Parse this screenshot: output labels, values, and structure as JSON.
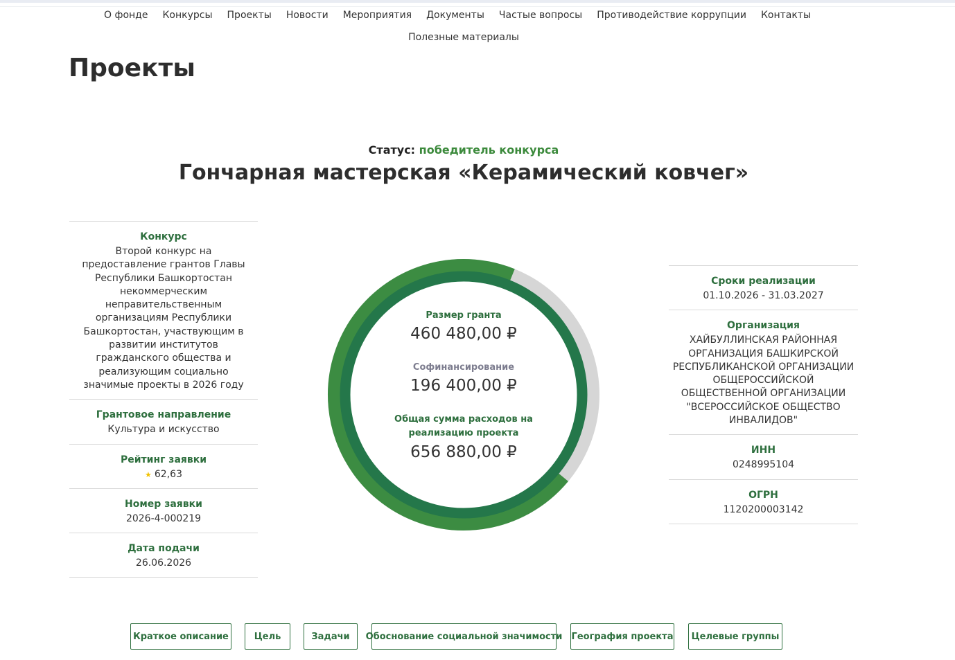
{
  "nav": {
    "items": [
      "О фонде",
      "Конкурсы",
      "Проекты",
      "Новости",
      "Мероприятия",
      "Документы",
      "Частые вопросы",
      "Противодействие коррупции",
      "Контакты"
    ],
    "second_row": "Полезные материалы"
  },
  "page_title": "Проекты",
  "status": {
    "label": "Статус:",
    "value": "победитель конкурса"
  },
  "project_title": "Гончарная мастерская «Керамический ковчег»",
  "left": {
    "competition": {
      "label": "Конкурс",
      "value": "Второй конкурс на предоставление грантов Главы Республики Башкортостан некоммерческим неправительственным организациям Республики Башкортостан, участвующим в развитии институтов гражданского общества и реализующим социально значимые проекты в 2026 году"
    },
    "direction": {
      "label": "Грантовое направление",
      "value": "Культура и искусство"
    },
    "rating": {
      "label": "Рейтинг заявки",
      "value": "62,63"
    },
    "number": {
      "label": "Номер заявки",
      "value": "2026-4-000219"
    },
    "date": {
      "label": "Дата подачи",
      "value": "26.06.2026"
    }
  },
  "center": {
    "grant": {
      "label": "Размер гранта",
      "value": "460 480,00 ₽"
    },
    "cofin": {
      "label": "Софинансирование",
      "value": "196 400,00 ₽"
    },
    "total": {
      "label": "Общая сумма расходов на реализацию проекта",
      "value": "656 880,00 ₽"
    },
    "grant_share": 0.701,
    "colors": {
      "grant": "#3c8c42",
      "cofin": "#d6d6d6",
      "inner": "#24774a"
    }
  },
  "right": {
    "period": {
      "label": "Сроки реализации",
      "value": "01.10.2026 - 31.03.2027"
    },
    "org": {
      "label": "Организация",
      "value": "ХАЙБУЛЛИНСКАЯ РАЙОННАЯ ОРГАНИЗАЦИЯ БАШКИРСКОЙ РЕСПУБЛИКАНСКОЙ ОРГАНИЗАЦИИ ОБЩЕРОССИЙСКОЙ ОБЩЕСТВЕННОЙ ОРГАНИЗАЦИИ \"ВСЕРОССИЙСКОЕ ОБЩЕСТВО ИНВАЛИДОВ\""
    },
    "inn": {
      "label": "ИНН",
      "value": "0248995104"
    },
    "ogrn": {
      "label": "ОГРН",
      "value": "1120200003142"
    }
  },
  "tabs": [
    "Краткое описание",
    "Цель",
    "Задачи",
    "Обоснование социальной значимости",
    "География проекта",
    "Целевые группы"
  ]
}
